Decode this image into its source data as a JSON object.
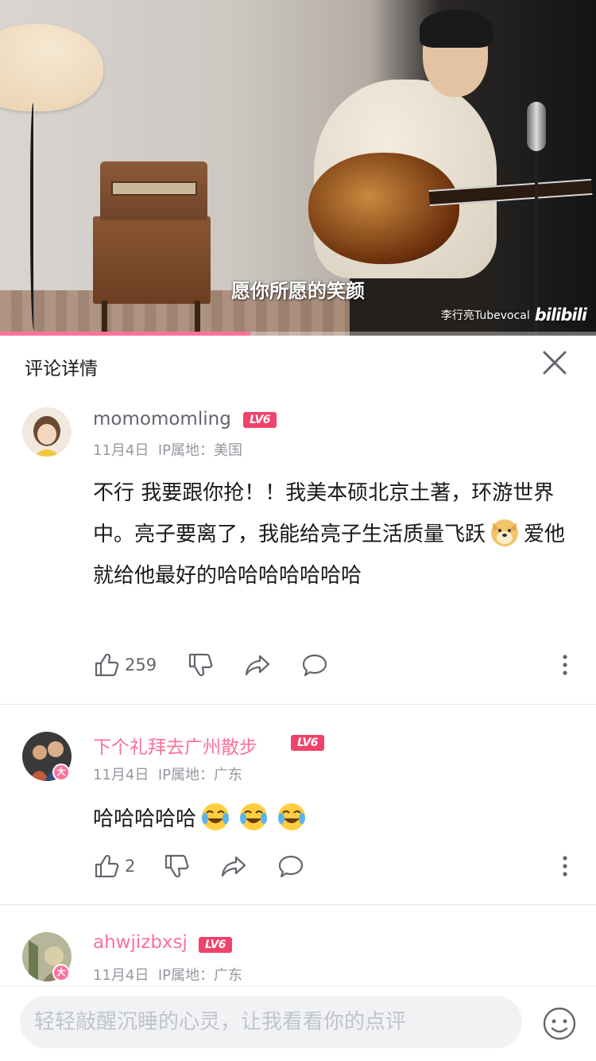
{
  "video": {
    "subtitle": "愿你所愿的笑颜",
    "uploader_watermark": "李行亮Tubevocal",
    "logo_text": "bilibili",
    "progress": 0.42
  },
  "header": {
    "title": "评论详情"
  },
  "comments": [
    {
      "username": "momomomling",
      "level": "LV6",
      "date": "11月4日",
      "ip_location": "IP属地：美国",
      "text_parts": [
        "不行 我要跟你抢！！我美本硕北京土著，环游世界中。亮子要离了，我能给亮子生活质量飞跃",
        "爱他 就给他最好的哈哈哈哈哈哈哈"
      ],
      "emoji": "doge-emoji",
      "likes": "259",
      "name_color": "#61666d"
    },
    {
      "username": "下个礼拜去广州散步",
      "level": "LV6",
      "date": "11月4日",
      "ip_location": "IP属地：广东",
      "text": "哈哈哈哈哈",
      "emojis": [
        "laugh-cry-emoji",
        "laugh-cry-emoji",
        "laugh-cry-emoji"
      ],
      "likes": "2",
      "name_color": "#fb7299",
      "avatar_badge": "大"
    },
    {
      "username": "ahwjizbxsj",
      "level": "LV6",
      "date": "11月4日",
      "ip_location": "IP属地：广东",
      "name_color": "#fb7299",
      "avatar_badge": "大"
    }
  ],
  "input": {
    "placeholder": "轻轻敲醒沉睡的心灵，让我看看你的点评"
  },
  "colors": {
    "accent": "#fb7299",
    "level_badge": "#f0426a",
    "meta_text": "#9499a0"
  }
}
